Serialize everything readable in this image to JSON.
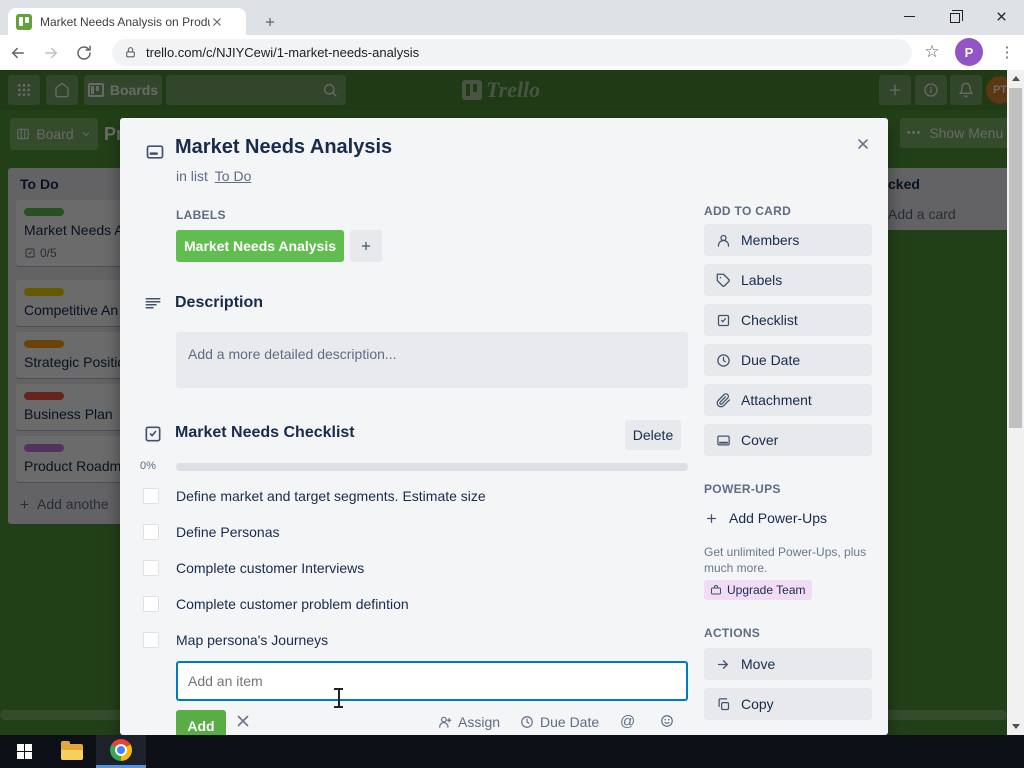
{
  "browser": {
    "tab_title": "Market Needs Analysis on Produ",
    "url": "trello.com/c/NJIYCewi/1-market-needs-analysis",
    "profile_initial": "P"
  },
  "trello_nav": {
    "boards_label": "Boards",
    "logo_text": "Trello",
    "avatar_initials": "PT"
  },
  "board_bar": {
    "board_button_label": "Board",
    "board_title_fragment": "Pr",
    "show_menu_dots": "•••",
    "show_menu_label": "Show Menu"
  },
  "board": {
    "left_list": {
      "title": "To Do",
      "cards": [
        {
          "title": "Market Needs A",
          "label_color": "#61bd4f",
          "badge": "0/5"
        },
        {
          "title": "Competitive An",
          "label_color": "#f2d600"
        },
        {
          "title": "Strategic Positio",
          "label_color": "#ff9f1a"
        },
        {
          "title": "Business Plan",
          "label_color": "#eb5a46"
        },
        {
          "title": "Product Roadm",
          "label_color": "#c377e0"
        }
      ],
      "add_card_label": "Add anothe"
    },
    "right_list": {
      "title_fragment": "cked",
      "add_card_label": "Add a card"
    }
  },
  "modal": {
    "title": "Market Needs Analysis",
    "in_list_prefix": "in list",
    "list_link": "To Do",
    "labels_heading": "LABELS",
    "label_text": "Market Needs Analysis",
    "description_heading": "Description",
    "description_placeholder": "Add a more detailed description...",
    "checklist": {
      "title": "Market Needs Checklist",
      "delete_label": "Delete",
      "percent": "0%",
      "items": [
        "Define market and target segments. Estimate size",
        "Define Personas",
        "Complete customer Interviews",
        "Complete customer problem defintion",
        "Map persona's Journeys"
      ],
      "add_item_placeholder": "Add an item",
      "add_button_label": "Add",
      "assign_label": "Assign",
      "due_date_label": "Due Date",
      "at_glyph": "@"
    },
    "sidebar": {
      "add_to_card_heading": "ADD TO CARD",
      "add_to_card_items": [
        "Members",
        "Labels",
        "Checklist",
        "Due Date",
        "Attachment",
        "Cover"
      ],
      "power_ups_heading": "POWER-UPS",
      "add_power_ups_label": "Add Power-Ups",
      "power_ups_note": "Get unlimited Power-Ups, plus much more.",
      "upgrade_team_label": "Upgrade Team",
      "actions_heading": "ACTIONS",
      "actions": [
        "Move",
        "Copy"
      ]
    }
  },
  "colors": {
    "board_green": "#519839",
    "label_green": "#61bd4f",
    "add_button_green": "#5aac44",
    "accent_blue": "#0079bf",
    "upgrade_badge_bg": "#f2dcf5",
    "nav_avatar_orange": "#d9832c",
    "profile_purple": "#9354c6"
  }
}
